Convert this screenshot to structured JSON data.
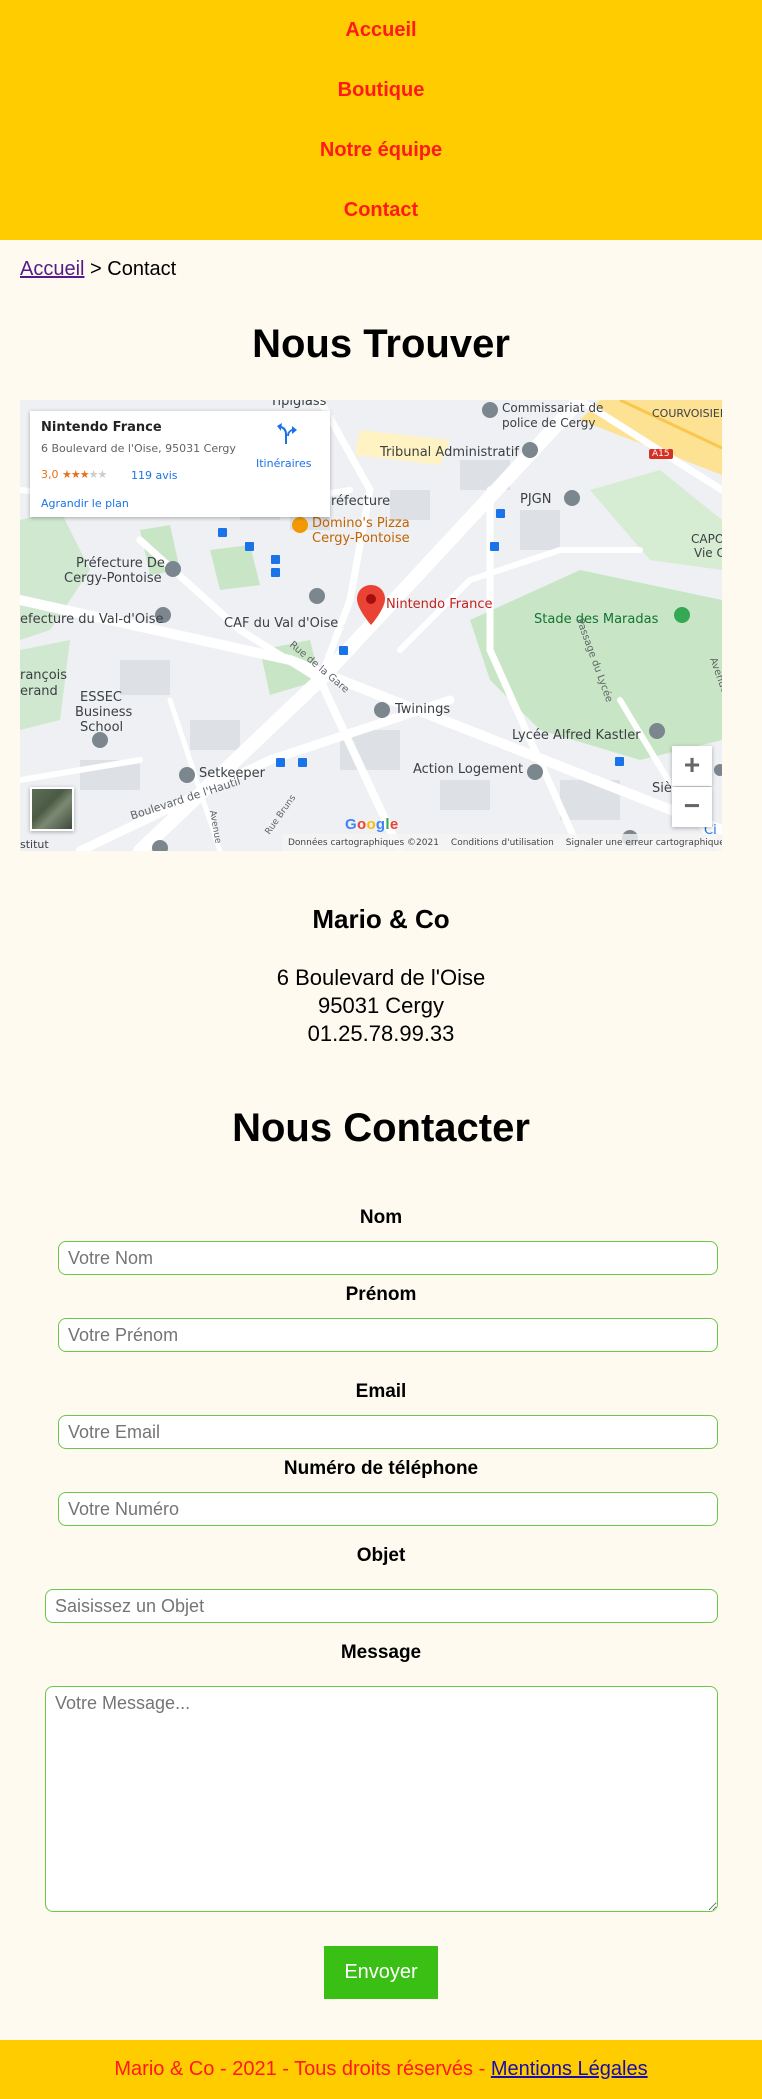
{
  "nav": {
    "items": [
      "Accueil",
      "Boutique",
      "Notre équipe",
      "Contact"
    ]
  },
  "breadcrumb": {
    "home": "Accueil",
    "separator": " > ",
    "current": "Contact"
  },
  "find_section": {
    "title": "Nous Trouver"
  },
  "map": {
    "place_name": "Nintendo France",
    "place_address": "6 Boulevard de l'Oise, 95031 Cergy",
    "rating": "3,0",
    "stars_filled": 3,
    "reviews": "119 avis",
    "enlarge_link": "Agrandir le plan",
    "directions_label": "Itinéraires",
    "directions_icon": "directions-icon",
    "marker_label": "Nintendo France",
    "labels": {
      "tipiglass": "Tipiglass",
      "commissariat": "Commissariat de",
      "commissariat2": "police de Cergy",
      "courvoisier": "COURVOISIER",
      "a15": "A15",
      "tribunal": "Tribunal Administratif",
      "pjgn": "PJGN",
      "prefecture_short": "réfecture",
      "dominos": "Domino's Pizza",
      "dominos2": "Cergy-Pontoise",
      "capoc": "CAPOC",
      "capoc2": "Vie C",
      "prefecture1": "Préfecture De",
      "prefecture2": "Cergy-Pontoise",
      "caf": "CAF du Val d'Oise",
      "val_oise": "efecture du Val-d'Oise",
      "stade": "Stade des Maradas",
      "rue_gare": "Rue de la Gare",
      "passage": "Passage du Lycée",
      "avenue": "Avenue",
      "francois": "rançois",
      "erand": "erand",
      "essec1": "ESSEC",
      "essec2": "Business",
      "essec3": "School",
      "twinings": "Twinings",
      "lycee": "Lycée Alfred Kastler",
      "setkeeper": "Setkeeper",
      "action_logement": "Action Logement",
      "siege": "Siè",
      "bd_hautil": "Boulevard de l'Hautil",
      "avenue2": "Avenue",
      "rue_bruns": "Rue Bruns",
      "stitut": "stitut",
      "ci": "Ci"
    },
    "zoom_in": "+",
    "zoom_out": "−",
    "google": [
      "G",
      "o",
      "o",
      "g",
      "l",
      "e"
    ],
    "footer": {
      "data": "Données cartographiques ©2021",
      "terms": "Conditions d'utilisation",
      "report": "Signaler une erreur cartographique"
    }
  },
  "company": {
    "name": "Mario & Co",
    "street": "6 Boulevard de l'Oise",
    "city": "95031 Cergy",
    "phone": "01.25.78.99.33"
  },
  "contact_section": {
    "title": "Nous Contacter"
  },
  "form": {
    "nom_label": "Nom",
    "nom_placeholder": "Votre Nom",
    "prenom_label": "Prénom",
    "prenom_placeholder": "Votre Prénom",
    "email_label": "Email",
    "email_placeholder": "Votre Email",
    "phone_label": "Numéro de téléphone",
    "phone_placeholder": "Votre Numéro",
    "objet_label": "Objet",
    "objet_placeholder": "Saisissez un Objet",
    "message_label": "Message",
    "message_placeholder": "Votre Message...",
    "submit": "Envoyer"
  },
  "footer": {
    "text": "Mario & Co - 2021 - Tous droits réservés - ",
    "legal_link": "Mentions Légales"
  },
  "colors": {
    "header_bg": "#ffcc00",
    "nav_link": "#ff1a1a",
    "page_bg": "#fefaf0",
    "input_border": "#6ac84a",
    "button_bg": "#3abf15"
  }
}
